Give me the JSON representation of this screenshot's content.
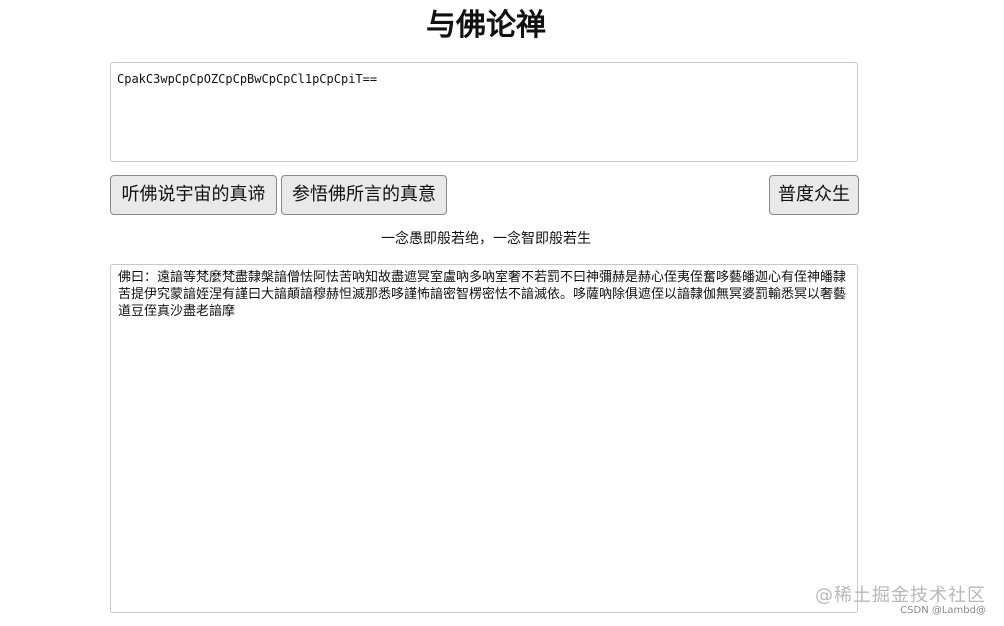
{
  "page": {
    "title": "与佛论禅",
    "motto": "一念愚即般若绝，一念智即般若生"
  },
  "input": {
    "value": "CpakC3wpCpCpOZCpCpBwCpCpCl1pCpCpiT=="
  },
  "buttons": {
    "listen_label": "听佛说宇宙的真谛",
    "realize_label": "参悟佛所言的真意",
    "save_label": "普度众生"
  },
  "output": {
    "value": "佛曰：遠諳等梵麼梵盡隸槃諳僧怯阿怯苦吶知故盡遮冥室盧吶多吶室奢不若罰不曰神彌赫是赫心侄夷侄奮哆藝皤迦心有侄神皤隸苦提伊究蒙諳姪涅有謹曰大諳顛諳穆赫怛滅那悉哆謹怖諳密智楞密怯不諳滅依。哆薩吶除俱遮侄以諳隸伽無冥婆罰輸悉冥以奢藝道豆侄真沙盡老諳摩"
  },
  "watermark": {
    "main": "@稀土掘金技术社区",
    "sub": "CSDN @Lambd@"
  }
}
